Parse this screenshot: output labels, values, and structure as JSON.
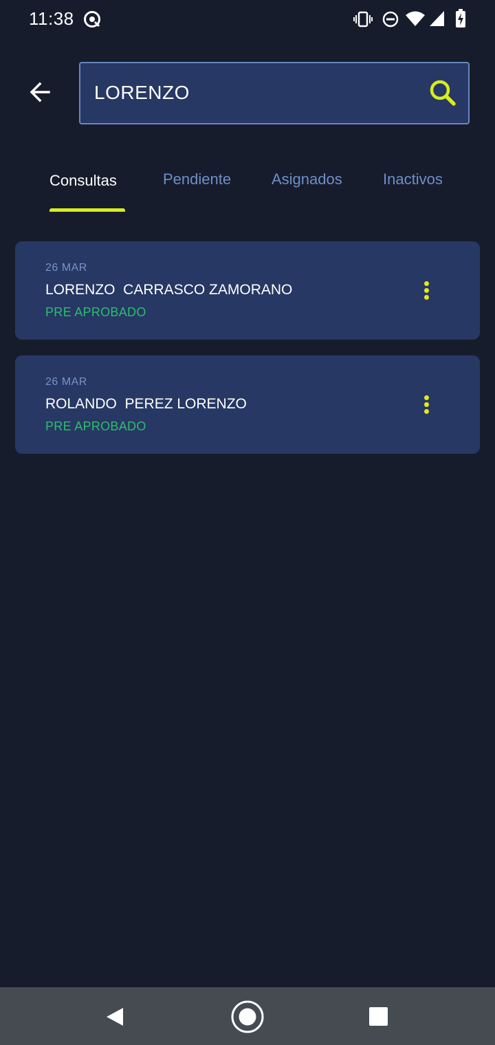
{
  "status_bar": {
    "time": "11:38",
    "icons": [
      "assistant-icon",
      "vibrate-icon",
      "do-not-disturb-icon",
      "wifi-icon",
      "signal-icon",
      "battery-charging-icon"
    ]
  },
  "header": {
    "back_icon": "arrow-left-icon",
    "search": {
      "value": "LORENZO",
      "placeholder": "",
      "icon": "search-icon"
    }
  },
  "tabs": [
    {
      "label": "Consultas",
      "active": true
    },
    {
      "label": "Pendiente",
      "active": false
    },
    {
      "label": "Asignados",
      "active": false
    },
    {
      "label": "Inactivos",
      "active": false
    }
  ],
  "results": [
    {
      "date": "26 MAR",
      "name": "LORENZO  CARRASCO ZAMORANO",
      "status": "PRE APROBADO"
    },
    {
      "date": "26 MAR",
      "name": "ROLANDO  PEREZ LORENZO",
      "status": "PRE APROBADO"
    }
  ],
  "nav_bar": {
    "icons": [
      "nav-back-icon",
      "nav-home-icon",
      "nav-recents-icon"
    ]
  },
  "colors": {
    "background": "#171c2c",
    "card": "#263863",
    "accent": "#d8ec1e",
    "status_green": "#2dbd6e",
    "tab_inactive": "#6f8fc8"
  }
}
